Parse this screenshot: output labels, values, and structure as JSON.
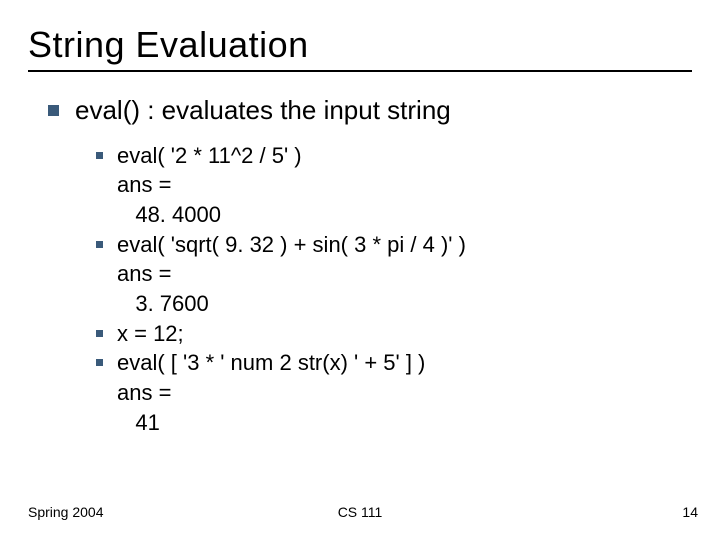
{
  "title": "String Evaluation",
  "bullet": {
    "label": "eval() : evaluates the input string",
    "items": [
      {
        "line": "eval( '2 * 11^2 / 5' )",
        "cont": [
          "ans =",
          "   48. 4000"
        ]
      },
      {
        "line": "eval( 'sqrt( 9. 32 ) + sin( 3 * pi / 4 )' )",
        "cont": [
          "ans =",
          "   3. 7600"
        ]
      },
      {
        "line": "x = 12;",
        "cont": []
      },
      {
        "line": "eval( [ '3 * ' num 2 str(x) ' + 5' ] )",
        "cont": [
          "ans =",
          "   41"
        ]
      }
    ]
  },
  "footer": {
    "left": "Spring 2004",
    "center": "CS 111",
    "right": "14"
  }
}
